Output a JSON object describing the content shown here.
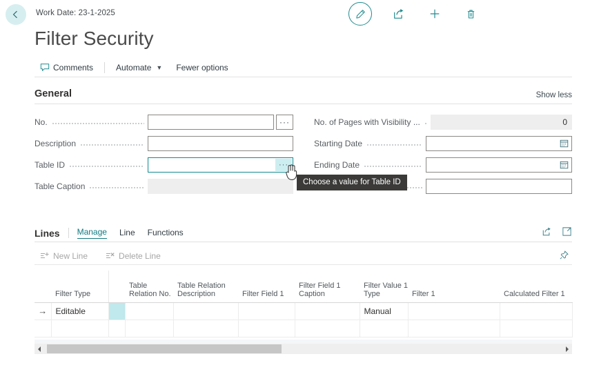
{
  "topbar": {
    "back_icon": "arrow-left-icon",
    "work_date": "Work Date: 23-1-2025",
    "actions": [
      {
        "name": "edit-button",
        "icon": "pencil-icon"
      },
      {
        "name": "share-button",
        "icon": "share-icon"
      },
      {
        "name": "new-button",
        "icon": "plus-icon"
      },
      {
        "name": "delete-button",
        "icon": "trash-icon"
      }
    ]
  },
  "page_title": "Filter Security",
  "commandbar": {
    "comments": "Comments",
    "automate": "Automate",
    "fewer_options": "Fewer options"
  },
  "general": {
    "heading": "General",
    "show_less": "Show less",
    "left_fields": [
      {
        "label": "No.",
        "value": "",
        "assist": "···",
        "readonly": false,
        "focused": false
      },
      {
        "label": "Description",
        "value": "",
        "readonly": false,
        "focused": false
      },
      {
        "label": "Table ID",
        "value": "",
        "assist": "···",
        "readonly": false,
        "focused": true
      },
      {
        "label": "Table Caption",
        "value": "",
        "readonly": true,
        "focused": false
      }
    ],
    "right_fields": [
      {
        "label": "No. of Pages with Visibility ...",
        "value": "0",
        "readonly": true,
        "align": "right"
      },
      {
        "label": "Starting Date",
        "value": "",
        "readonly": false,
        "icon": "calendar-icon"
      },
      {
        "label": "Ending Date",
        "value": "",
        "readonly": false,
        "icon": "calendar-icon"
      },
      {
        "label": "",
        "value": "",
        "readonly": false
      }
    ]
  },
  "tooltip": {
    "text": "Choose a value for Table ID"
  },
  "lines": {
    "title": "Lines",
    "tabs": [
      {
        "label": "Manage",
        "active": true
      },
      {
        "label": "Line",
        "active": false
      },
      {
        "label": "Functions",
        "active": false
      }
    ],
    "header_icons": [
      {
        "name": "share-lines-icon",
        "icon": "share-icon"
      },
      {
        "name": "open-full-page-icon",
        "icon": "expand-icon"
      }
    ],
    "commands": [
      {
        "label": "New Line",
        "icon": "new-line-icon",
        "disabled": true
      },
      {
        "label": "Delete Line",
        "icon": "delete-line-icon",
        "disabled": true
      }
    ],
    "pin_icon": "pin-icon",
    "columns": [
      "Filter Type",
      "",
      "Table Relation No.",
      "Table Relation Description",
      "Filter Field 1",
      "Filter Field 1 Caption",
      "Filter Value 1 Type",
      "Filter 1",
      "Calculated Filter 1"
    ],
    "rows": [
      {
        "indicator": "→",
        "cells": [
          "Editable",
          "",
          "",
          "",
          "",
          "",
          "Manual",
          "",
          ""
        ],
        "selected_cell_index": 1
      },
      {
        "indicator": "",
        "cells": [
          "",
          "",
          "",
          "",
          "",
          "",
          "",
          "",
          ""
        ],
        "selected_cell_index": -1
      }
    ],
    "hscroll": {
      "left_arrow": "◀",
      "right_arrow": "▶"
    }
  },
  "colors": {
    "accent": "#0f7a82",
    "accent_light": "#d6eef0",
    "selection": "#bfe9ec",
    "tooltip_bg": "#3b3a39",
    "readonly_bg": "#eeeeee"
  }
}
